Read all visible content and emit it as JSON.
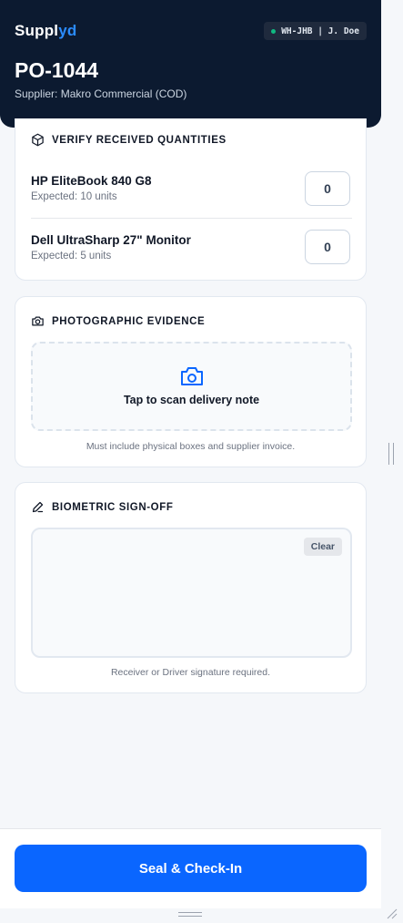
{
  "header": {
    "brand_prefix": "Suppl",
    "brand_accent": "yd",
    "context": "WH-JHB | J. Doe",
    "po_number": "PO-1044",
    "supplier": "Supplier: Makro Commercial (COD)"
  },
  "verify": {
    "title": "VERIFY RECEIVED QUANTITIES",
    "icon": "box-icon",
    "items": [
      {
        "name": "HP EliteBook 840 G8",
        "expected": "Expected: 10 units",
        "qty": "0"
      },
      {
        "name": "Dell UltraSharp 27\" Monitor",
        "expected": "Expected: 5 units",
        "qty": "0"
      }
    ]
  },
  "photo": {
    "title": "PHOTOGRAPHIC EVIDENCE",
    "icon": "camera-icon",
    "scan_label": "Tap to scan delivery note",
    "helper": "Must include physical boxes and supplier invoice."
  },
  "signoff": {
    "title": "BIOMETRIC SIGN-OFF",
    "icon": "pen-icon",
    "clear_label": "Clear",
    "helper": "Receiver or Driver signature required."
  },
  "footer": {
    "submit_label": "Seal & Check-In"
  },
  "colors": {
    "header_bg": "#0c1a30",
    "brand_accent": "#2b8cff",
    "primary": "#0a66ff",
    "status": "#10b981"
  }
}
